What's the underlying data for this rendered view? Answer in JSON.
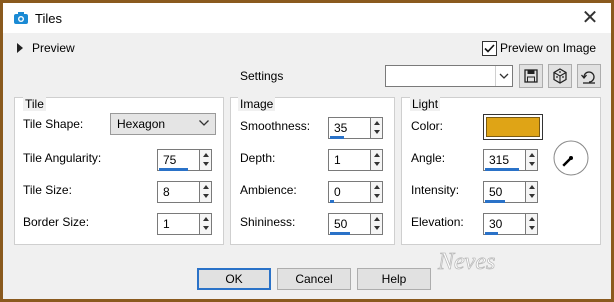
{
  "window": {
    "title": "Tiles",
    "close_glyph": "✕"
  },
  "preview": {
    "label": "Preview",
    "checkbox_label": "Preview on Image",
    "checkbox_checked": true
  },
  "settings": {
    "label": "Settings",
    "value": ""
  },
  "toolbar_icons": [
    "save-preset-icon",
    "randomize-icon",
    "reset-icon"
  ],
  "tile": {
    "group_label": "Tile",
    "shape_label": "Tile Shape:",
    "shape_value": "Hexagon",
    "angularity_label": "Tile Angularity:",
    "angularity_value": "75",
    "angularity_max": 100,
    "size_label": "Tile Size:",
    "size_value": "8",
    "border_label": "Border Size:",
    "border_value": "1"
  },
  "image": {
    "group_label": "Image",
    "smoothness_label": "Smoothness:",
    "smoothness_value": "35",
    "depth_label": "Depth:",
    "depth_value": "1",
    "ambience_label": "Ambience:",
    "ambience_value": "0",
    "shininess_label": "Shininess:",
    "shininess_value": "50"
  },
  "light": {
    "group_label": "Light",
    "color_label": "Color:",
    "color_value": "#DFA416",
    "angle_label": "Angle:",
    "angle_value": "315",
    "intensity_label": "Intensity:",
    "intensity_value": "50",
    "elevation_label": "Elevation:",
    "elevation_value": "30"
  },
  "fill_fractions": {
    "angularity": 0.75,
    "smoothness": 0.35,
    "ambience": 0.1,
    "shininess": 0.5,
    "angle": 0.875,
    "intensity": 0.5,
    "elevation": 0.33
  },
  "buttons": {
    "ok": "OK",
    "cancel": "Cancel",
    "help": "Help"
  },
  "accent_color": "#2A72C8",
  "frame_color": "#8A5A1E"
}
